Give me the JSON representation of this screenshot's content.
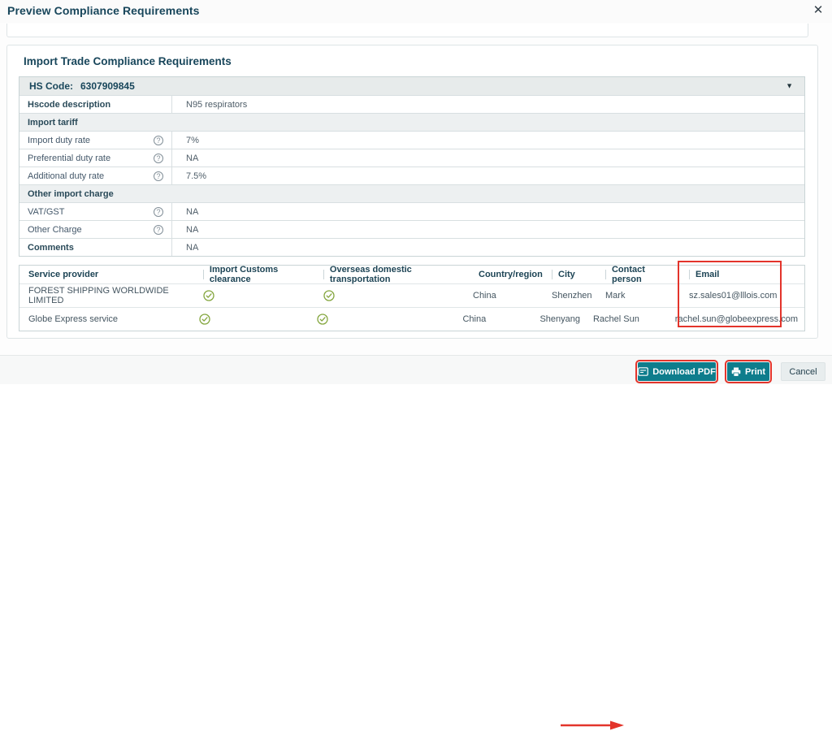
{
  "modal": {
    "title": "Preview Compliance Requirements",
    "close_icon": "✕"
  },
  "main": {
    "heading": "Import Trade Compliance Requirements"
  },
  "hs_panel": {
    "code_label": "HS Code:",
    "code_value": "6307909845",
    "collapse_icon": "▼",
    "help_icon": "?",
    "rows": [
      {
        "type": "kv-bold",
        "label": "Hscode description",
        "value": "N95 respirators"
      },
      {
        "type": "section",
        "label": "Import tariff"
      },
      {
        "type": "kv-help",
        "label": "Import duty rate",
        "value": "7%"
      },
      {
        "type": "kv-help",
        "label": "Preferential duty rate",
        "value": "NA"
      },
      {
        "type": "kv-help",
        "label": "Additional duty rate",
        "value": "7.5%"
      },
      {
        "type": "section",
        "label": "Other import charge"
      },
      {
        "type": "kv-help",
        "label": "VAT/GST",
        "value": "NA"
      },
      {
        "type": "kv-help",
        "label": "Other Charge",
        "value": "NA"
      },
      {
        "type": "kv-bold",
        "label": "Comments",
        "value": "NA"
      }
    ]
  },
  "provider_table": {
    "headers": {
      "provider": "Service provider",
      "import_customs": "Import Customs clearance",
      "overseas": "Overseas domestic transportation",
      "country": "Country/region",
      "city": "City",
      "contact": "Contact person",
      "email": "Email"
    },
    "rows": [
      {
        "provider": "FOREST SHIPPING WORLDWIDE LIMITED",
        "import_customs": true,
        "overseas": true,
        "country": "China",
        "city": "Shenzhen",
        "contact": "Mark",
        "email": "sz.sales01@lllois.com"
      },
      {
        "provider": "Globe Express service",
        "import_customs": true,
        "overseas": true,
        "country": "China",
        "city": "Shenyang",
        "contact": "Rachel Sun",
        "email": "rachel.sun@globeexpress.com"
      }
    ]
  },
  "footer": {
    "download_label": "Download PDF",
    "print_label": "Print",
    "cancel_label": "Cancel"
  },
  "colors": {
    "accent_teal": "#0E7D8C",
    "annotation_red": "#E3342B",
    "check_green": "#84A63E",
    "heading": "#18465B"
  }
}
